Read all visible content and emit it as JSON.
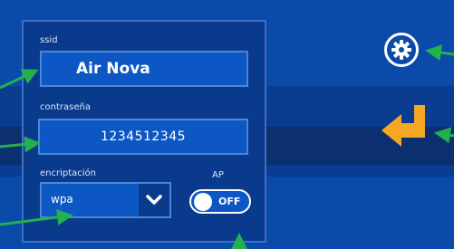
{
  "form": {
    "ssid_label": "ssid",
    "ssid_value": "Air Nova",
    "password_label": "contraseña",
    "password_value": "1234512345",
    "encryption_label": "encriptación",
    "encryption_value": "wpa",
    "ap_label": "AP",
    "ap_toggle_state": "OFF"
  },
  "icons": {
    "settings": "gear-icon",
    "enter": "enter-arrow-icon",
    "dropdown": "chevron-down-icon"
  },
  "colors": {
    "background": "#0a4aa8",
    "panel": "#0a3a8c",
    "field": "#0c57c4",
    "accent_orange": "#f5a623",
    "annotation_green": "#22b14c"
  }
}
